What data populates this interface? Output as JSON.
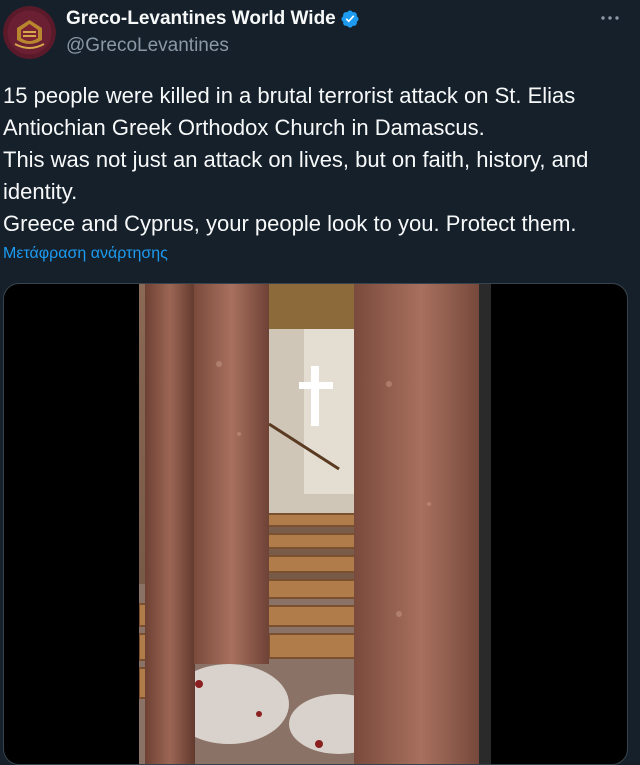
{
  "tweet": {
    "display_name": "Greco-Levantines World Wide",
    "handle": "@GrecoLevantines",
    "text_lines": [
      "15 people were killed in a brutal terrorist attack on St. Elias Antiochian Greek Orthodox Church in Damascus.",
      "This was not just an attack on lives, but on faith, history, and identity.",
      "Greece and Cyprus, your people look to you. Protect them."
    ],
    "translate_label": "Μετάφραση ανάρτησης"
  },
  "icons": {
    "verified": "verified-badge-icon",
    "more": "more-options-icon",
    "avatar": "crest-logo"
  },
  "colors": {
    "background": "#15202b",
    "text": "#f7f9f9",
    "secondary_text": "#8b98a5",
    "link": "#1d9bf0",
    "verified": "#1d9bf0"
  }
}
